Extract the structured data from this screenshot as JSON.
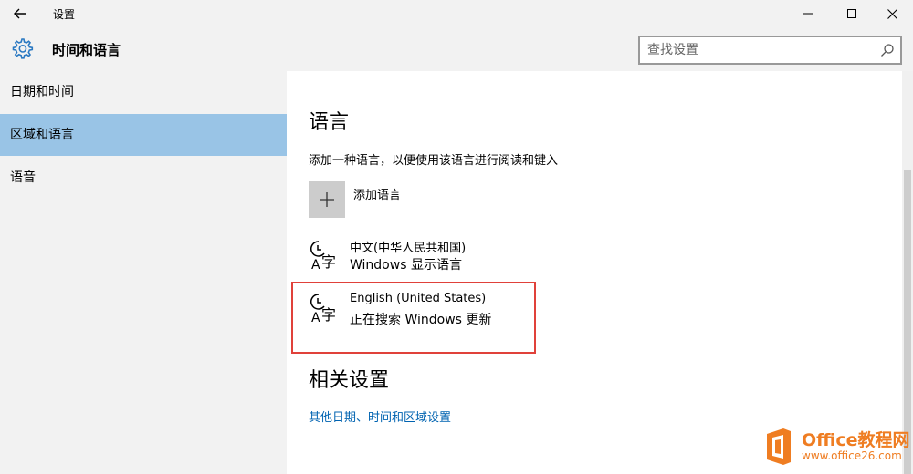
{
  "window": {
    "title": "设置"
  },
  "header": {
    "title": "时间和语言"
  },
  "search": {
    "placeholder": "查找设置"
  },
  "sidebar": {
    "items": [
      {
        "label": "日期和时间",
        "selected": false
      },
      {
        "label": "区域和语言",
        "selected": true
      },
      {
        "label": "语音",
        "selected": false
      }
    ]
  },
  "language": {
    "heading": "语言",
    "description": "添加一种语言，以便使用该语言进行阅读和键入",
    "add_label": "添加语言",
    "items": [
      {
        "name": "中文(中华人民共和国)",
        "status": "Windows 显示语言"
      },
      {
        "name": "English (United States)",
        "status": "正在搜索 Windows 更新"
      }
    ]
  },
  "related": {
    "heading": "相关设置",
    "link": "其他日期、时间和区域设置"
  },
  "watermark": {
    "name": "Office教程网",
    "url": "www.office26.com"
  },
  "colors": {
    "selected_nav": "#99c4e6",
    "link": "#0063b1",
    "highlight_border": "#e0413a",
    "watermark": "#ef7d22"
  },
  "icons": [
    "back-arrow-icon",
    "minimize-icon",
    "maximize-icon",
    "close-icon",
    "gear-icon",
    "search-icon",
    "plus-icon",
    "language-icon",
    "office-logo-icon"
  ]
}
